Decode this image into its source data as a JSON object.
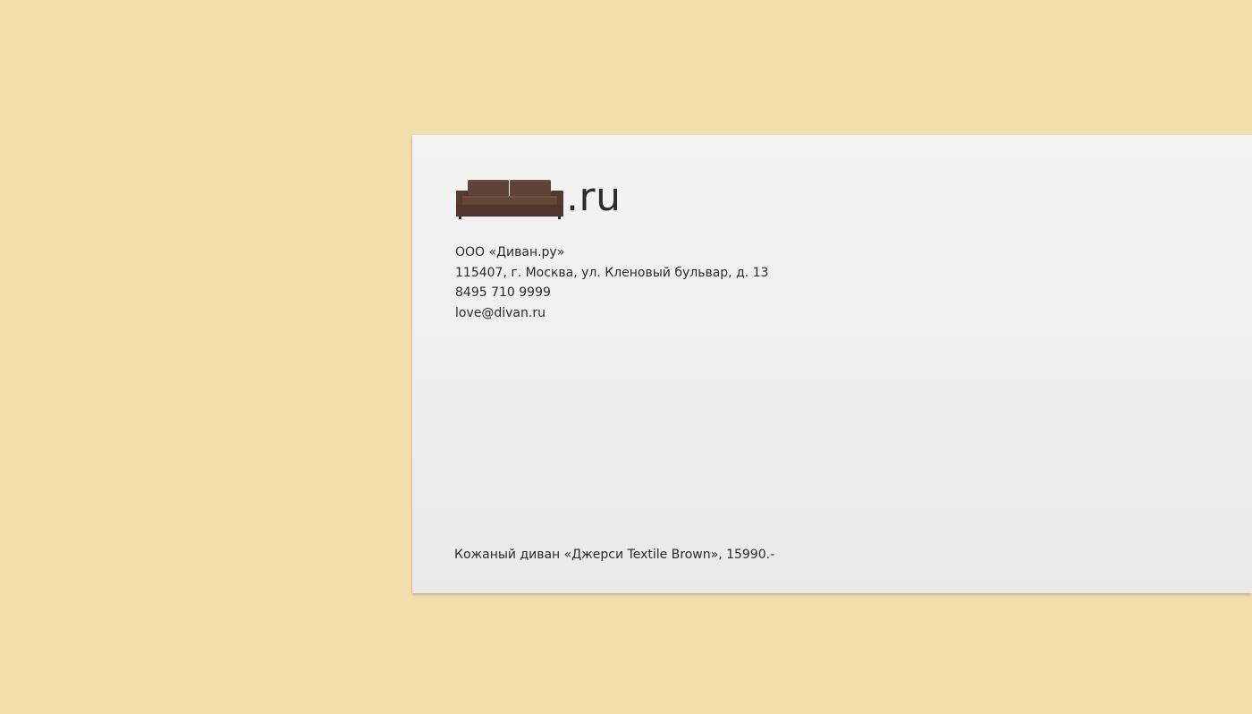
{
  "logo": {
    "icon": "sofa-icon",
    "suffix": ".ru",
    "sofa_color": "#5a4034"
  },
  "address": {
    "company": "ООО «Диван.ру»",
    "street": "115407, г. Москва, ул. Кленовый бульвар, д. 13",
    "phone": "8495 710 9999",
    "email": "love@divan.ru"
  },
  "caption": "Кожаный диван «Джерси Textile Brown», 15990.-",
  "colors": {
    "background": "#f2dfac",
    "envelope": "#eeeeee",
    "text": "#2a2a2a"
  }
}
